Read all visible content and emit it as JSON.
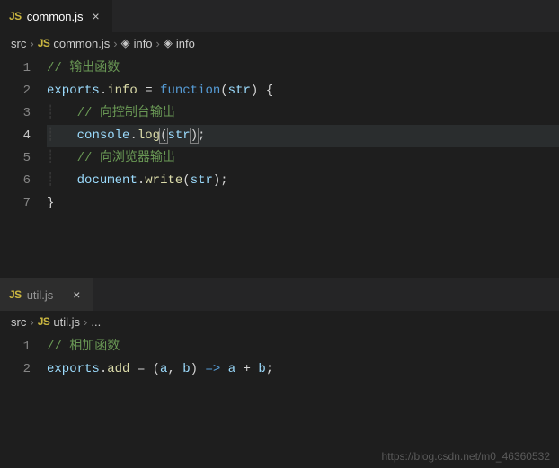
{
  "top": {
    "tab": {
      "icon_label": "JS",
      "filename": "common.js",
      "close": "×"
    },
    "breadcrumb": {
      "src": "src",
      "file_icon": "JS",
      "file": "common.js",
      "sym1": "info",
      "sym2": "info"
    },
    "lines": {
      "l1a": "// ",
      "l1b": "输出函数",
      "l2a": "exports",
      "l2b": ".",
      "l2c": "info",
      "l2d": " = ",
      "l2e": "function",
      "l2f": "(",
      "l2g": "str",
      "l2h": ") {",
      "l3a": "// ",
      "l3b": "向控制台输出",
      "l4a": "console",
      "l4b": ".",
      "l4c": "log",
      "l4d": "(",
      "l4e": "str",
      "l4f": ")",
      "l4g": ";",
      "l5a": "// ",
      "l5b": "向浏览器输出",
      "l6a": "document",
      "l6b": ".",
      "l6c": "write",
      "l6d": "(",
      "l6e": "str",
      "l6f": ");",
      "l7a": "}"
    },
    "lineno": {
      "n1": "1",
      "n2": "2",
      "n3": "3",
      "n4": "4",
      "n5": "5",
      "n6": "6",
      "n7": "7"
    }
  },
  "bottom": {
    "tab": {
      "icon_label": "JS",
      "filename": "util.js",
      "close": "×"
    },
    "breadcrumb": {
      "src": "src",
      "file_icon": "JS",
      "file": "util.js",
      "more": "..."
    },
    "lines": {
      "l1a": "// ",
      "l1b": "相加函数",
      "l2a": "exports",
      "l2b": ".",
      "l2c": "add",
      "l2d": " = (",
      "l2e": "a",
      "l2f": ", ",
      "l2g": "b",
      "l2h": ") ",
      "l2i": "=>",
      "l2j": " ",
      "l2k": "a",
      "l2l": " + ",
      "l2m": "b",
      "l2n": ";"
    },
    "lineno": {
      "n1": "1",
      "n2": "2"
    }
  },
  "watermark": "https://blog.csdn.net/m0_46360532"
}
